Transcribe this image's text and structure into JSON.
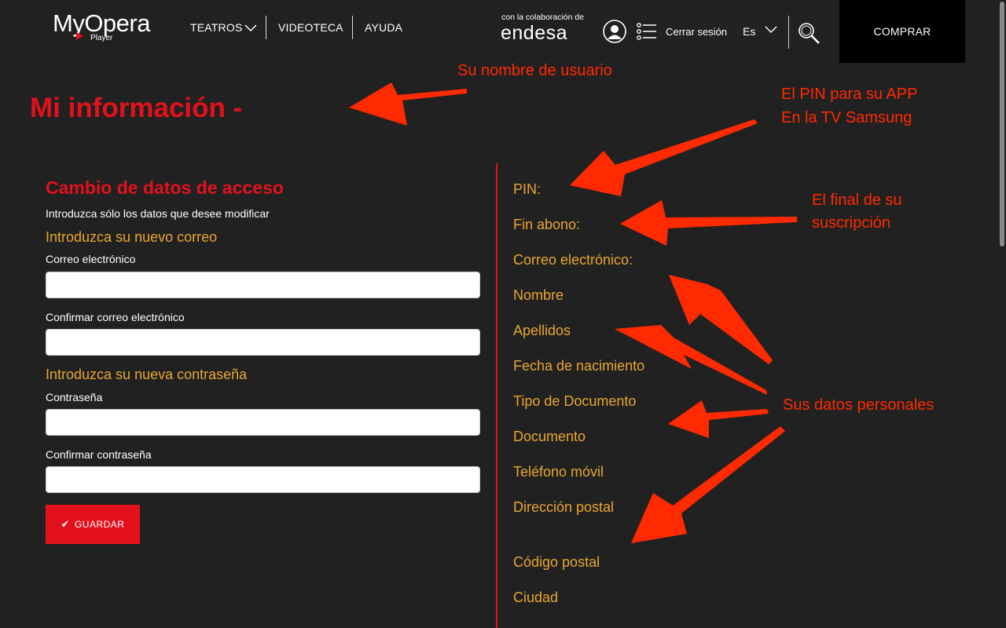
{
  "header": {
    "logo_text": "MyOpera",
    "logo_sub": "Player",
    "nav": [
      "TEATROS",
      "VIDEOTECA",
      "AYUDA"
    ],
    "partner_caption": "con la colaboración de",
    "partner_logo": "endesa",
    "logout_label": "Cerrar sesión",
    "language": "Es",
    "buy_label": "COMPRAR"
  },
  "page_title": "Mi información -",
  "form": {
    "section_title": "Cambio de datos de acceso",
    "intro": "Introduzca sólo los datos que desee modificar",
    "email_heading": "Introduzca su nuevo correo",
    "email_label": "Correo electrónico",
    "email_confirm_label": "Confirmar correo electrónico",
    "password_heading": "Introduzca su nueva contraseña",
    "password_label": "Contraseña",
    "password_confirm_label": "Confirmar contraseña",
    "save_label": "GUARDAR"
  },
  "info_labels": [
    "PIN:",
    "Fin abono:",
    "Correo electrónico:",
    "Nombre",
    "Apellidos",
    "Fecha de nacimiento",
    "Tipo de Documento",
    "Documento",
    "Teléfono móvil",
    "Dirección postal",
    "Código postal",
    "Ciudad"
  ],
  "annotations": {
    "username": "Su nombre de usuario",
    "pin_line1": "El PIN para su APP",
    "pin_line2": "En la TV Samsung",
    "end_line1": "El final de su",
    "end_line2": "suscripción",
    "personal": "Sus datos personales"
  },
  "colors": {
    "background": "#222121",
    "accent_red": "#e3111b",
    "label_orange": "#e8a631",
    "annotation_red": "#ff2a00"
  }
}
